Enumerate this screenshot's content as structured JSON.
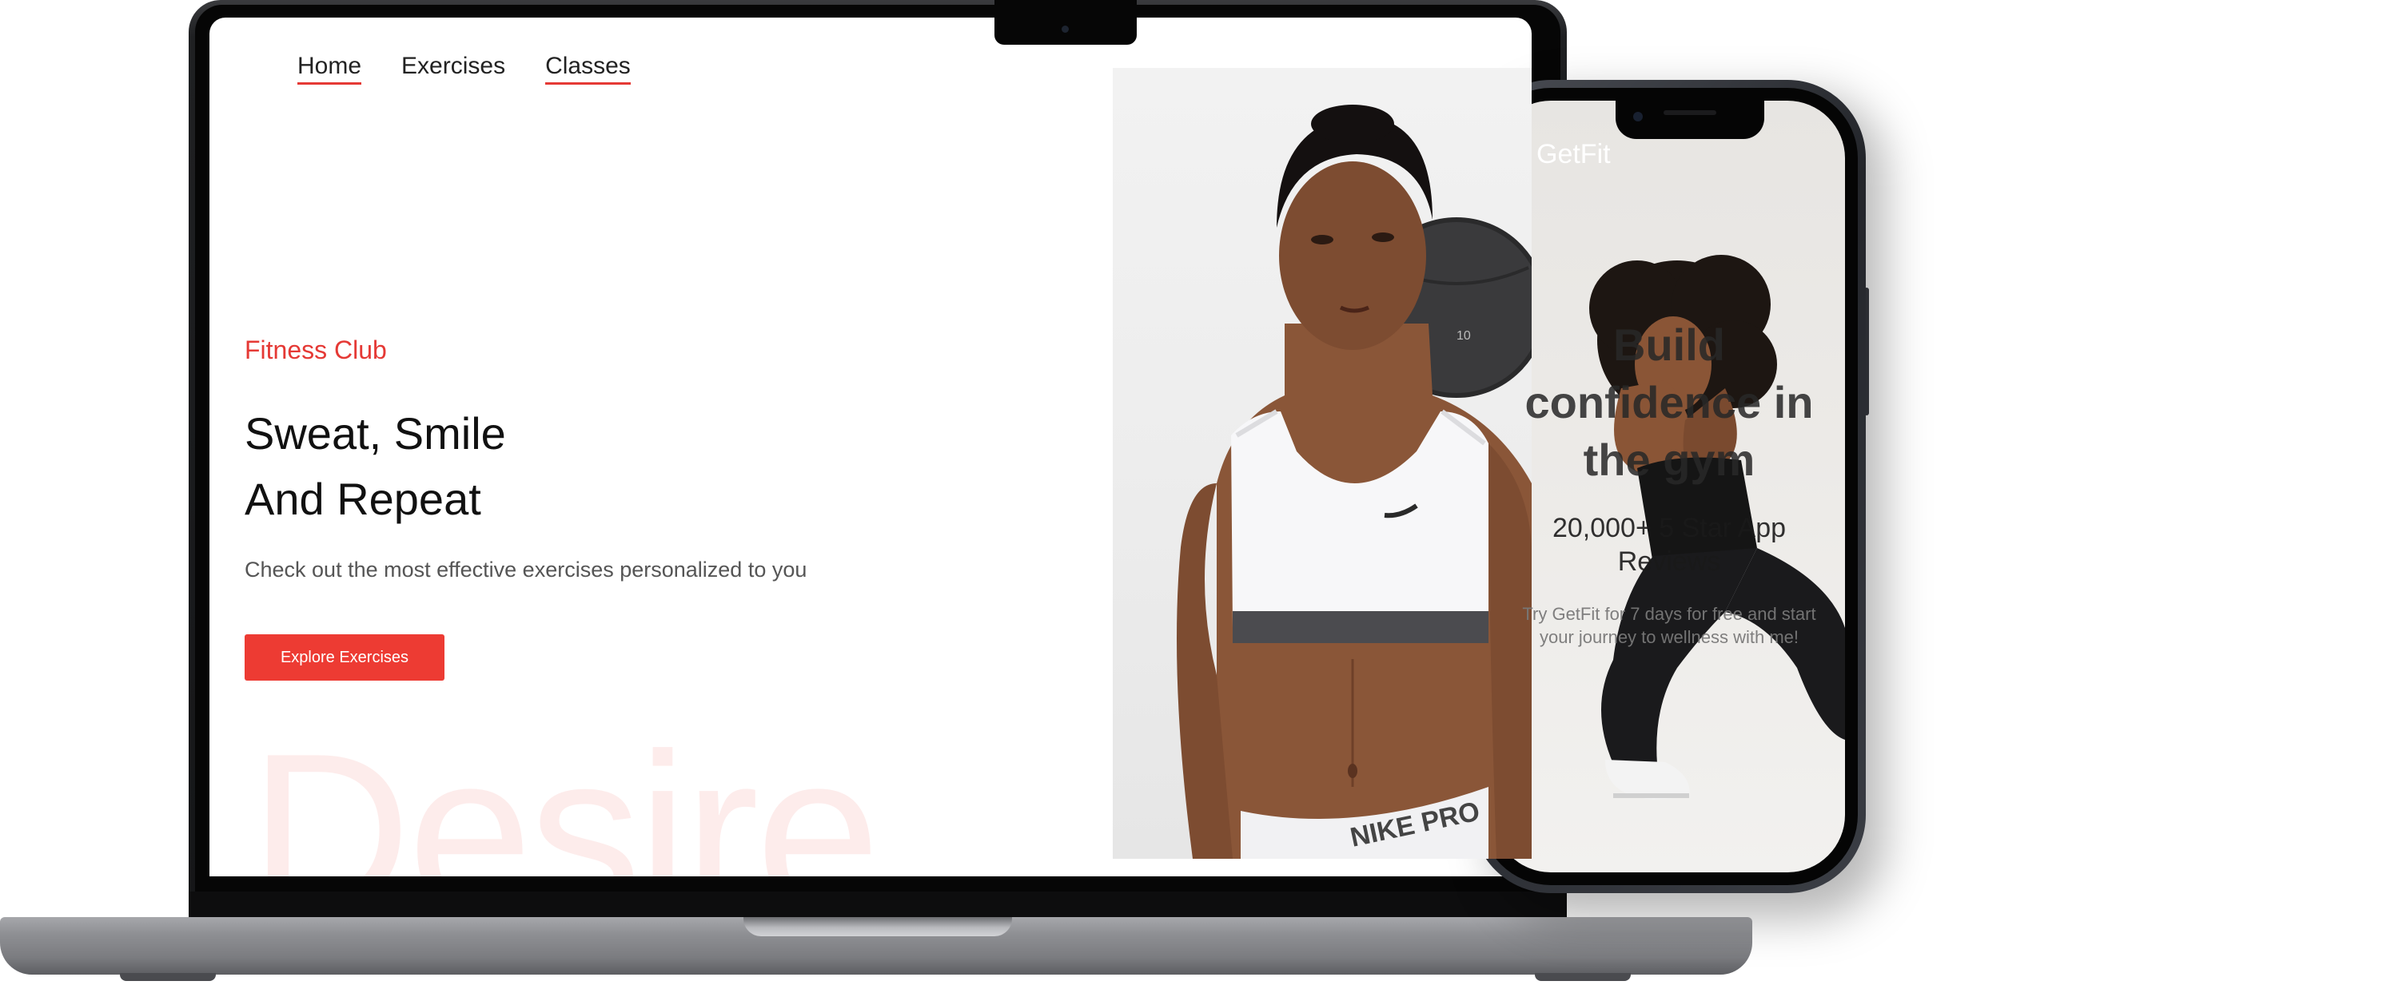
{
  "laptop": {
    "nav": {
      "items": [
        {
          "label": "Home",
          "active": true
        },
        {
          "label": "Exercises",
          "active": false
        },
        {
          "label": "Classes",
          "active": true
        }
      ]
    },
    "hero": {
      "eyebrow": "Fitness Club",
      "title_line_1": "Sweat, Smile",
      "title_line_2": "And Repeat",
      "subtitle": "Check out the most effective exercises personalized to you",
      "cta_label": "Explore Exercises",
      "background_word": "Desire",
      "shorts_print": "NIKE PRO"
    }
  },
  "phone": {
    "logo": "GetFit",
    "headline_line_1": "Build",
    "headline_line_2": "confidence in",
    "headline_line_3": "the gym",
    "reviews_line_1": "20,000+ 5 Star App",
    "reviews_line_2": "Reviews",
    "tagline_line_1": "Try GetFit for 7 days for free and start",
    "tagline_line_2": "your journey to wellness with me!"
  },
  "colors": {
    "accent": "#ed3b33",
    "background_word": "#fdeceb",
    "text_dark": "#111111"
  }
}
